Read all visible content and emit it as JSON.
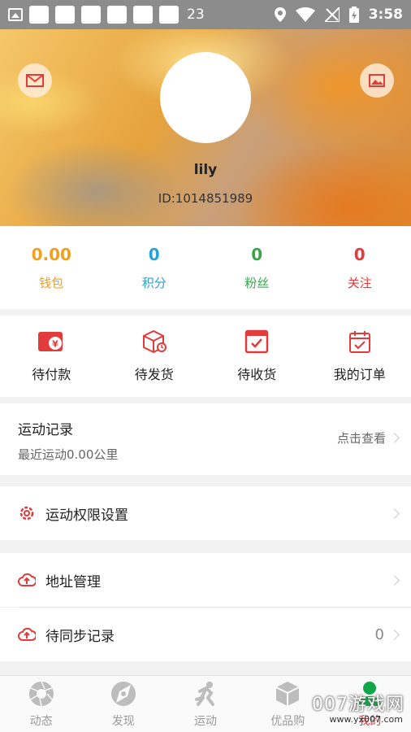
{
  "status_bar": {
    "notification_count": "23",
    "time": "3:58"
  },
  "profile": {
    "name": "lily",
    "id": "ID:1014851989"
  },
  "stats": [
    {
      "value": "0.00",
      "label": "钱包",
      "color": "#f0a020"
    },
    {
      "value": "0",
      "label": "积分",
      "color": "#27a3d8"
    },
    {
      "value": "0",
      "label": "粉丝",
      "color": "#3aa64b"
    },
    {
      "value": "0",
      "label": "关注",
      "color": "#e23b3b"
    }
  ],
  "orders": [
    {
      "label": "待付款",
      "icon": "wallet-yuan-icon"
    },
    {
      "label": "待发货",
      "icon": "package-icon"
    },
    {
      "label": "待收货",
      "icon": "box-check-icon"
    },
    {
      "label": "我的订单",
      "icon": "calendar-check-icon"
    }
  ],
  "exercise": {
    "title": "运动记录",
    "subtitle": "最近运动0.00公里",
    "link": "点击查看"
  },
  "settings_row": {
    "label": "运动权限设置",
    "icon": "gear-icon"
  },
  "address_row": {
    "label": "地址管理",
    "icon": "cloud-upload-icon"
  },
  "sync_row": {
    "label": "待同步记录",
    "icon": "cloud-upload-icon",
    "count": "0"
  },
  "bottom_nav": [
    {
      "label": "动态",
      "icon": "aperture-icon"
    },
    {
      "label": "发现",
      "icon": "compass-icon"
    },
    {
      "label": "运动",
      "icon": "runner-icon"
    },
    {
      "label": "优品购",
      "icon": "cube-icon"
    },
    {
      "label": "我的",
      "icon": "person-icon"
    }
  ],
  "watermark": {
    "text": "007游戏网",
    "sub": "www.yx007.com"
  },
  "colors": {
    "accent": "#e23b3b"
  }
}
